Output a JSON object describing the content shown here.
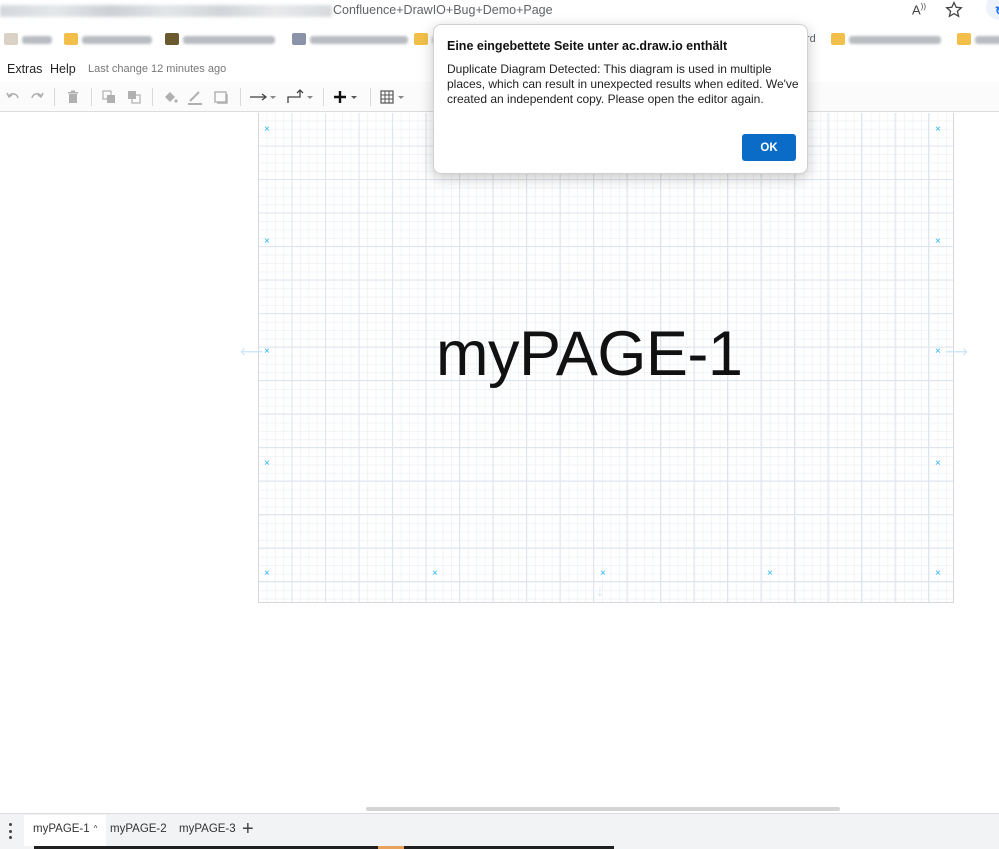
{
  "browser": {
    "url_visible_text": "Confluence+DrawIO+Bug+Demo+Page",
    "read_aloud_icon": "read-aloud-icon",
    "favorite_icon": "star-icon",
    "bookmark_fragment": "rd"
  },
  "menubar": {
    "items": [
      "Extras",
      "Help"
    ],
    "last_change": "Last change 12 minutes ago"
  },
  "toolbar": {
    "icons": [
      "undo-icon",
      "redo-icon",
      "delete-icon",
      "to-front-icon",
      "to-back-icon",
      "fill-color-icon",
      "line-color-icon",
      "shadow-icon",
      "connection-icon",
      "waypoints-icon",
      "insert-icon",
      "table-icon"
    ]
  },
  "canvas": {
    "page_label": "myPAGE-1",
    "grid_color": "#dfe5ec",
    "handle_color": "#29b6f2"
  },
  "pages": {
    "tabs": [
      {
        "label": "myPAGE-1",
        "active": true
      },
      {
        "label": "myPAGE-2",
        "active": false
      },
      {
        "label": "myPAGE-3",
        "active": false
      }
    ],
    "add_label": "+"
  },
  "dialog": {
    "title": "Eine eingebettete Seite unter ac.draw.io enthält",
    "message": "Duplicate Diagram Detected: This diagram is used in multiple places, which can result in unexpected results when edited. We've created an independent copy. Please open the editor again.",
    "ok_label": "OK",
    "accent_color": "#0b6cc7"
  }
}
